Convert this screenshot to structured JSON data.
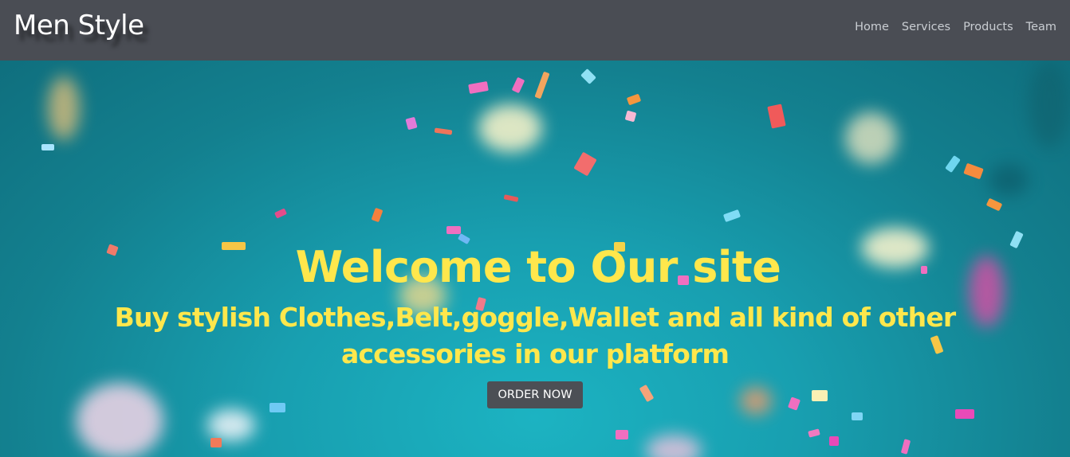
{
  "header": {
    "brand": "Men Style",
    "nav": [
      {
        "label": "Home"
      },
      {
        "label": "Services"
      },
      {
        "label": "Products"
      },
      {
        "label": "Team"
      }
    ]
  },
  "hero": {
    "title": "Welcome to Our site",
    "subtitle": "Buy stylish Clothes,Belt,goggle,Wallet and all kind of other accessories in our platform",
    "cta_label": "ORDER NOW",
    "background_image": "confetti on teal background"
  },
  "colors": {
    "navbar_bg": "#4a4d54",
    "hero_text": "#ffe74c",
    "button_bg": "#4c4f55",
    "nav_text": "#c9cdd2"
  }
}
